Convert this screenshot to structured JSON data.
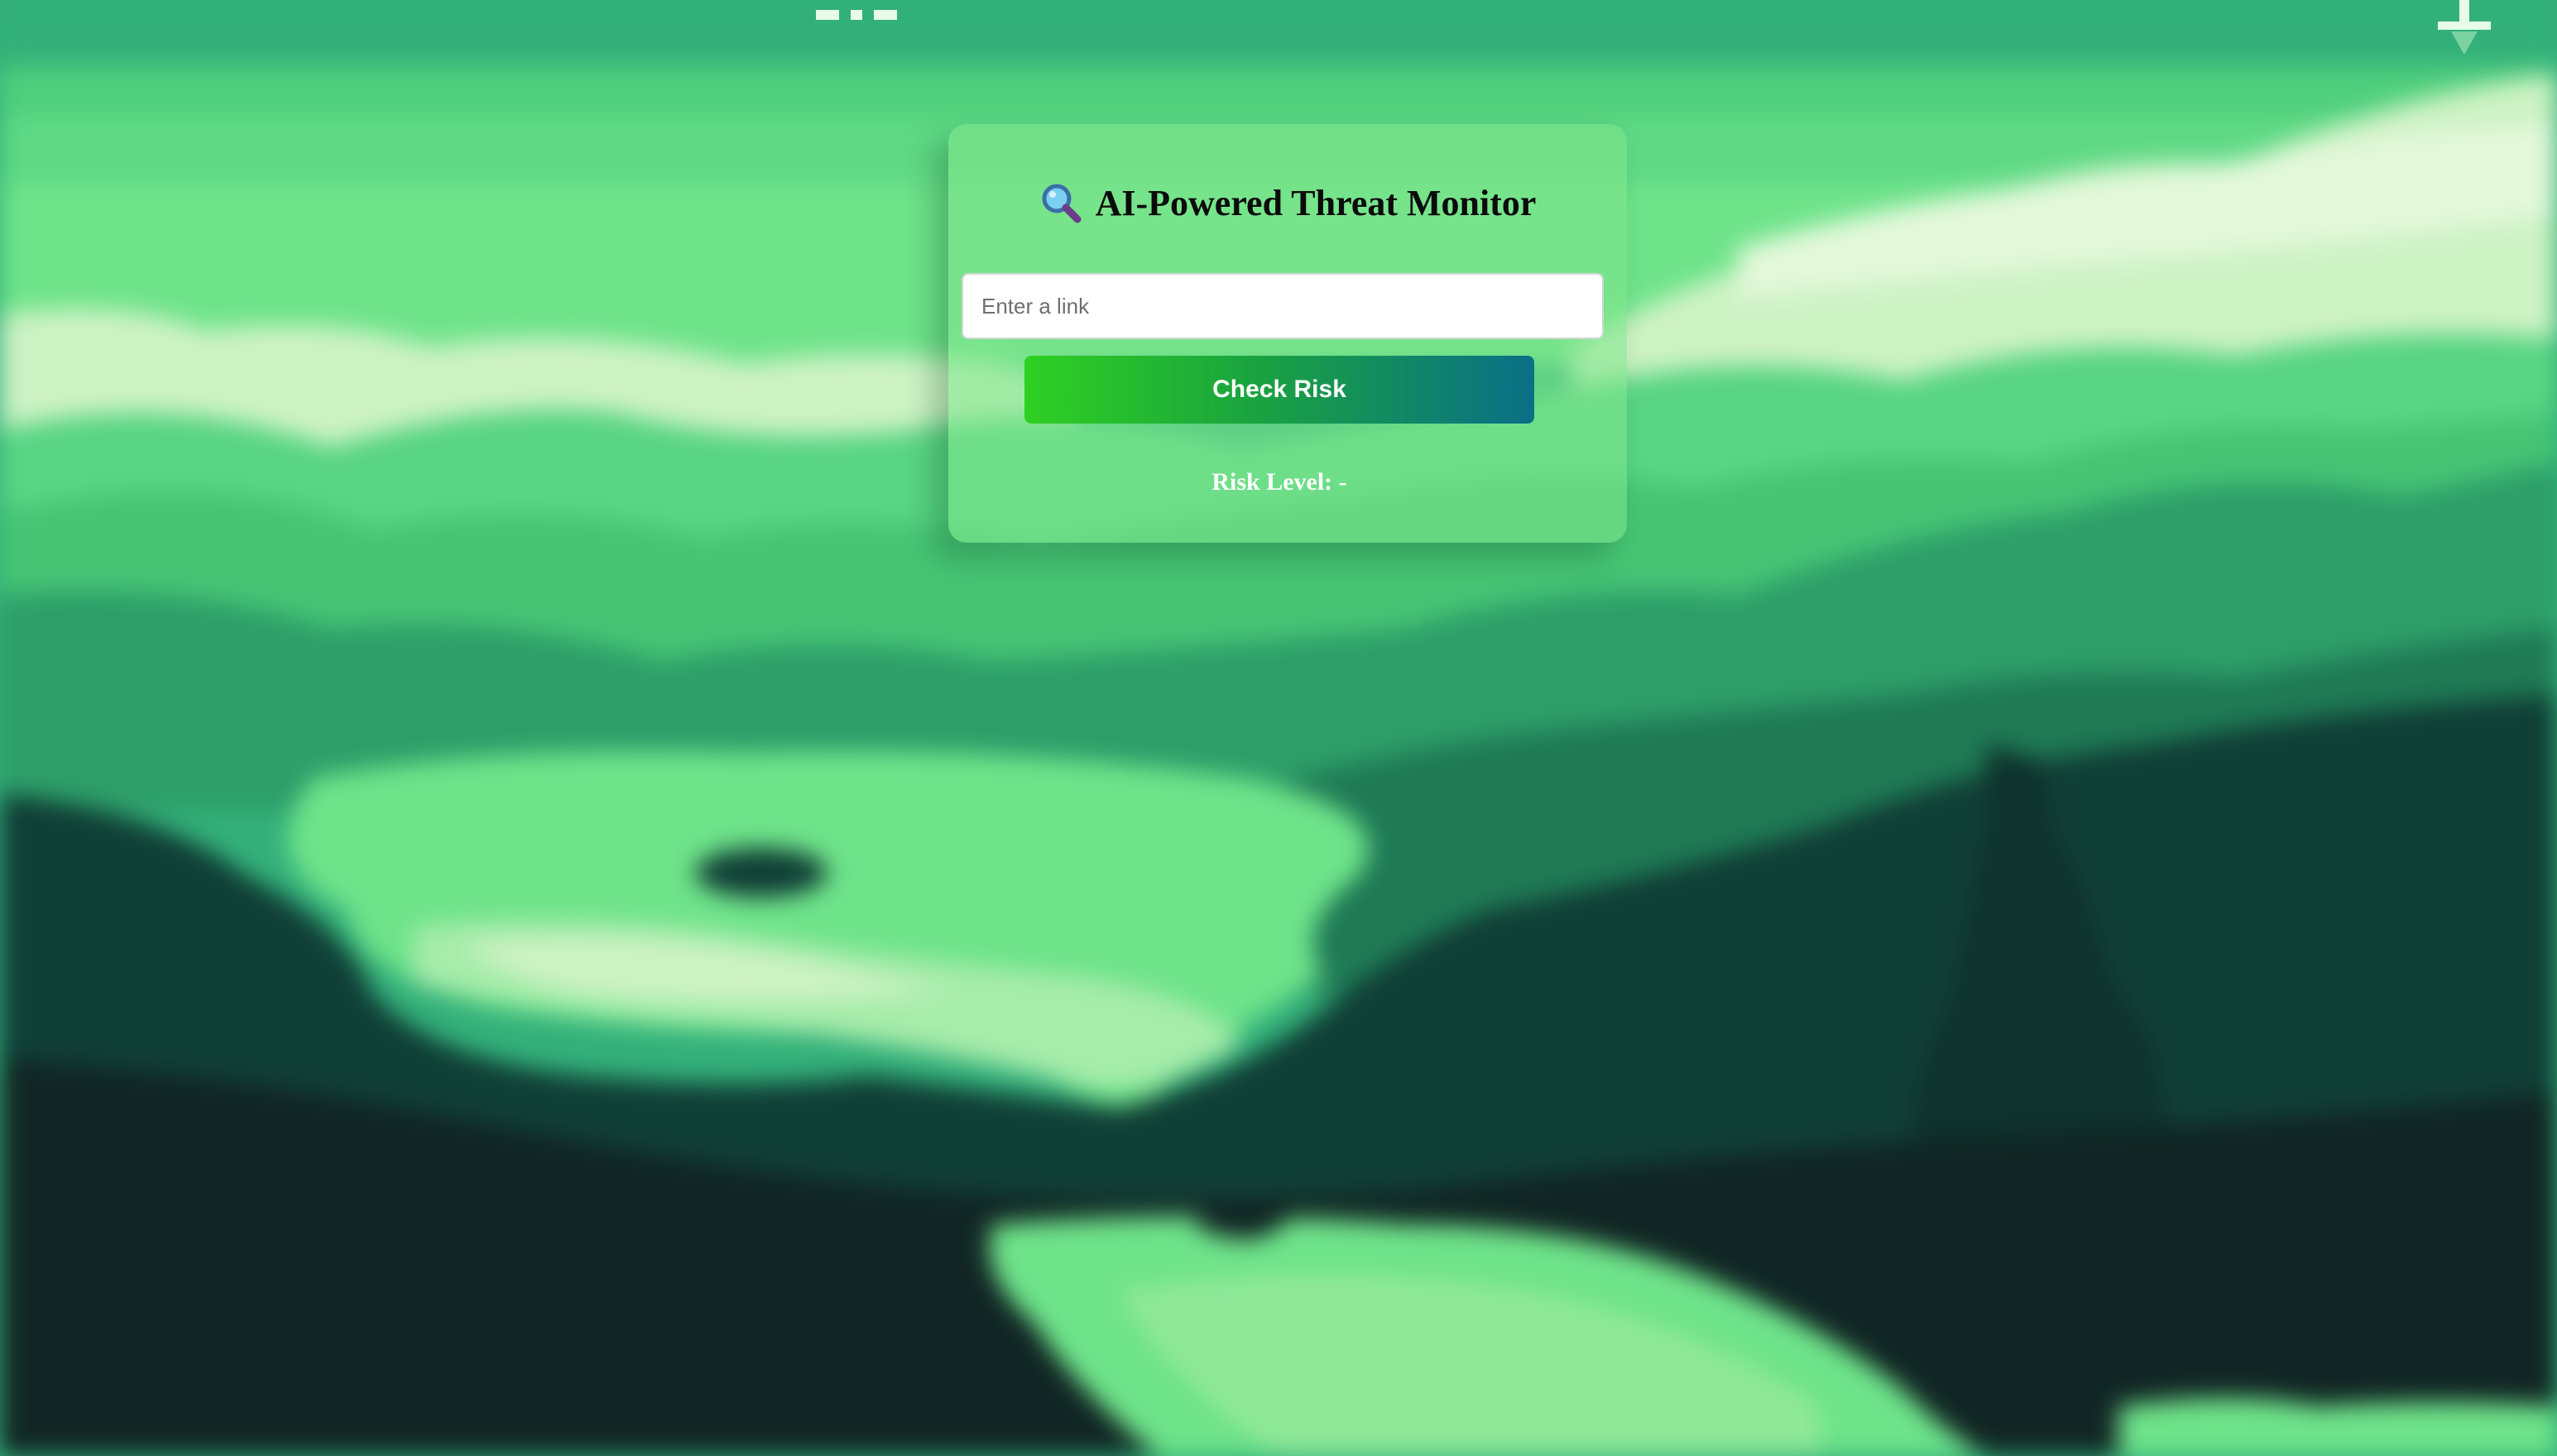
{
  "app": {
    "title_icon": "magnifying-glass-icon",
    "title": "AI-Powered Threat Monitor"
  },
  "form": {
    "link_placeholder": "Enter a link",
    "link_value": "",
    "check_button_label": "Check Risk"
  },
  "result": {
    "risk_text": "Risk Level: -"
  },
  "background": {
    "theme": "pixel-art green mountain lake landscape",
    "colors": {
      "sky": "#33b07a",
      "light_band": "#6ee38a",
      "cloud": "#cdf2c4",
      "mountain_mid": "#46c474",
      "mountain_dark": "#1f7a55",
      "forest_dark": "#103f36",
      "ground": "#112624",
      "lake": "#6ee38a"
    }
  },
  "accent": {
    "button_gradient_start": "#2fd022",
    "button_gradient_end": "#0a6f87"
  },
  "corner_icons": {
    "top_left_marks": "pixel-dash-icon",
    "top_right": "download-arrow-icon"
  }
}
